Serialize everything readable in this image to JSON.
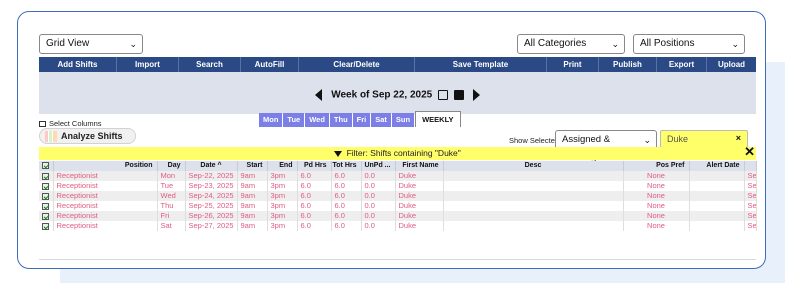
{
  "top_selects": {
    "view": "Grid View",
    "categories": "All Categories",
    "positions": "All Positions"
  },
  "toolbar": [
    "Add Shifts",
    "Import",
    "Search",
    "AutoFill",
    "Clear/Delete",
    "Save Template",
    "Print",
    "Publish",
    "Export",
    "Upload"
  ],
  "week": {
    "title": "Week of Sep 22, 2025",
    "days": [
      "Mon",
      "Tue",
      "Wed",
      "Thu",
      "Fri",
      "Sat",
      "Sun"
    ],
    "active_tab": "WEEKLY"
  },
  "select_columns": "Select Columns",
  "analyze": "Analyze Shifts",
  "show_selected_label": "Show Selected Only",
  "assign_select": "Assigned & Unassigned",
  "filter_input": "Duke",
  "filter_clear": "×",
  "filter_banner": "Filter: Shifts containing \"Duke\"",
  "filter_close": "✕",
  "table": {
    "headers": [
      "",
      "Position",
      "Day",
      "Date ^",
      "Start",
      "End",
      "Pd Hrs",
      "Tot Hrs",
      "UnPd ...",
      "First Name",
      "Desc",
      "Pos Pref",
      "Alert Date",
      ""
    ],
    "rows": [
      [
        "Receptionist",
        "Mon",
        "Sep-22, 2025",
        "9am",
        "3pm",
        "6.0",
        "6.0",
        "0.0",
        "Duke",
        "",
        "None",
        "",
        "Sep"
      ],
      [
        "Receptionist",
        "Tue",
        "Sep-23, 2025",
        "9am",
        "3pm",
        "6.0",
        "6.0",
        "0.0",
        "Duke",
        "",
        "None",
        "",
        "Sep"
      ],
      [
        "Receptionist",
        "Wed",
        "Sep-24, 2025",
        "9am",
        "3pm",
        "6.0",
        "6.0",
        "0.0",
        "Duke",
        "",
        "None",
        "",
        "Sep"
      ],
      [
        "Receptionist",
        "Thu",
        "Sep-25, 2025",
        "9am",
        "3pm",
        "6.0",
        "6.0",
        "0.0",
        "Duke",
        "",
        "None",
        "",
        "Sep"
      ],
      [
        "Receptionist",
        "Fri",
        "Sep-26, 2025",
        "9am",
        "3pm",
        "6.0",
        "6.0",
        "0.0",
        "Duke",
        "",
        "None",
        "",
        "Sep"
      ],
      [
        "Receptionist",
        "Sat",
        "Sep-27, 2025",
        "9am",
        "3pm",
        "6.0",
        "6.0",
        "0.0",
        "Duke",
        "",
        "None",
        "",
        "Sep"
      ]
    ]
  },
  "colors": {
    "toolbar_bg": "#2b4a85",
    "day_tab": "#7b7fe6",
    "row_text": "#e15b83",
    "filter_yellow": "#ffff6a",
    "card_border": "#3e6db5"
  }
}
